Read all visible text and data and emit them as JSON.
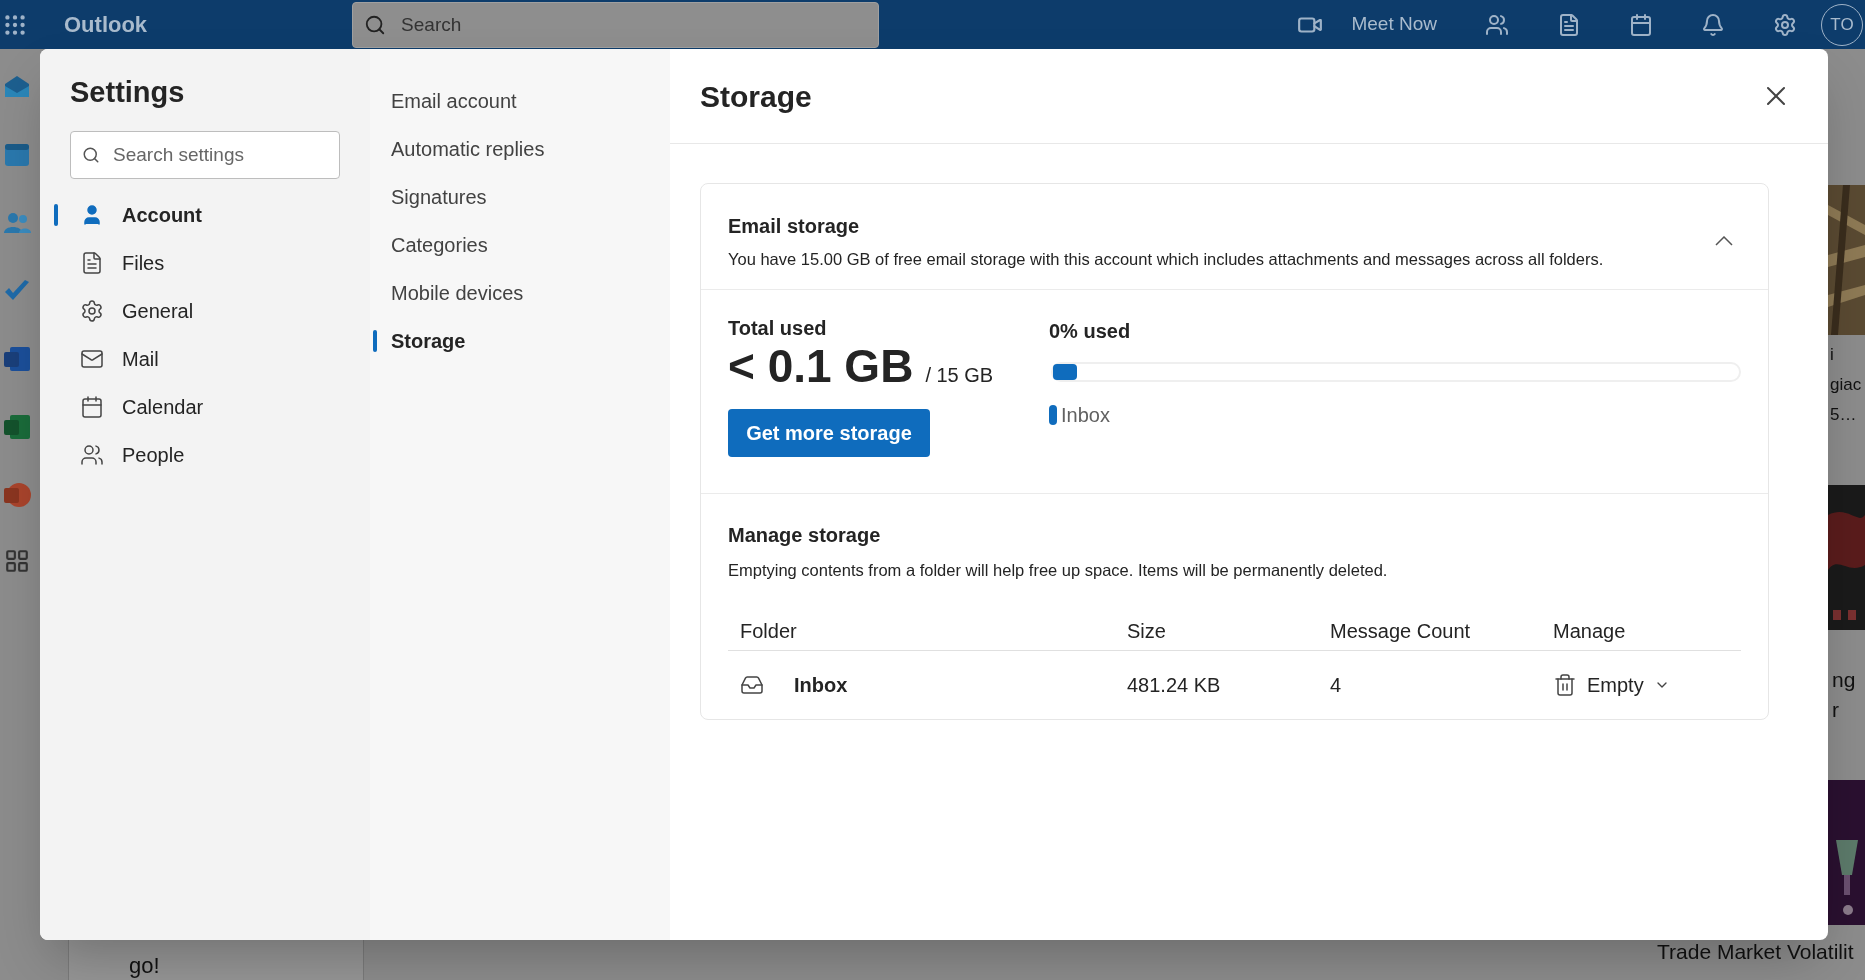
{
  "top_bar": {
    "app_name": "Outlook",
    "search": {
      "placeholder": "Search"
    },
    "meet_now": "Meet Now",
    "avatar": "TO"
  },
  "background": {
    "left_card_text": "go!",
    "side_texts": [
      "i",
      "giac",
      "5…"
    ],
    "side_texts_2": [
      "ng",
      "r"
    ],
    "bottom_headline": "Trade Market Volatilit"
  },
  "settings": {
    "title": "Settings",
    "search": {
      "placeholder": "Search settings"
    },
    "categories": [
      {
        "label": "Account",
        "selected": true
      },
      {
        "label": "Files",
        "selected": false
      },
      {
        "label": "General",
        "selected": false
      },
      {
        "label": "Mail",
        "selected": false
      },
      {
        "label": "Calendar",
        "selected": false
      },
      {
        "label": "People",
        "selected": false
      }
    ],
    "subcategories": [
      {
        "label": "Email account",
        "selected": false
      },
      {
        "label": "Automatic replies",
        "selected": false
      },
      {
        "label": "Signatures",
        "selected": false
      },
      {
        "label": "Categories",
        "selected": false
      },
      {
        "label": "Mobile devices",
        "selected": false
      },
      {
        "label": "Storage",
        "selected": true
      }
    ]
  },
  "panel": {
    "title": "Storage",
    "email_storage": {
      "title": "Email storage",
      "description": "You have 15.00 GB of free email storage with this account which includes attachments and messages across all folders.",
      "expanded": true
    },
    "usage": {
      "label": "Total used",
      "amount": "< 0.1 GB",
      "total": "/ 15 GB",
      "button": "Get more storage",
      "percent": "0% used",
      "level": 0.035,
      "legend": "Inbox"
    },
    "manage": {
      "title": "Manage storage",
      "description": "Emptying contents from a folder will help free up space. Items will be permanently deleted.",
      "columns": [
        "Folder",
        "Size",
        "Message Count",
        "Manage"
      ],
      "rows": [
        {
          "folder": "Inbox",
          "size": "481.24 KB",
          "count": "4",
          "action": "Empty"
        }
      ]
    }
  }
}
